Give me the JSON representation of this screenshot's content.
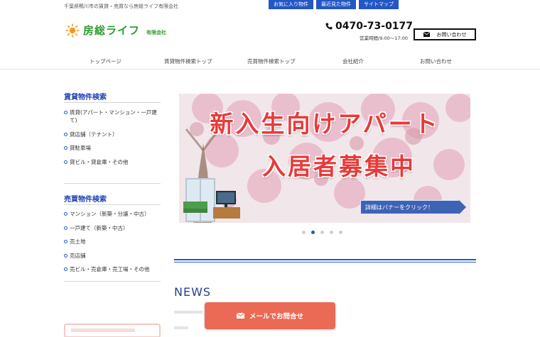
{
  "header": {
    "tagline": "千葉県鴨川市の賃貸・売買なら房総ライフ有限会社",
    "quicklinks": [
      "お気に入り物件",
      "最近見た物件",
      "サイトマップ"
    ],
    "logo_text": "房総ライフ",
    "logo_sub": "有限会社",
    "phone": "0470-73-0177",
    "hours": "営業時間/9:00〜17:00",
    "contact_label": "お問い合わせ"
  },
  "nav": [
    "トップページ",
    "賃貸物件検索トップ",
    "売買物件検索トップ",
    "会社紹介",
    "お問い合わせ"
  ],
  "sidebar": {
    "rental_title": "賃貸物件検索",
    "rental_items": [
      "賃貸(アパート・マンション・一戸建て)",
      "貸店舗（テナント）",
      "貸駐車場",
      "貸ビル・貸倉庫・その他"
    ],
    "sale_title": "売買物件検索",
    "sale_items": [
      "マンション（新築・分譲・中古）",
      "一戸建て（新築・中古）",
      "売土地",
      "売店舗",
      "売ビル・売倉庫・売工場・その他"
    ]
  },
  "banner": {
    "line1": "新入生向けアパート",
    "line2": "入居者募集中",
    "cta": "詳細はバナーをクリック！",
    "slide_count": 5,
    "active_slide": 2
  },
  "news_title": "NEWS",
  "mail_button": "メールでお問合せ",
  "colors": {
    "brand_blue": "#2457c6",
    "logo_green": "#2e9a32",
    "banner_red": "#e83a3a",
    "mail_btn": "#ea6a56"
  }
}
